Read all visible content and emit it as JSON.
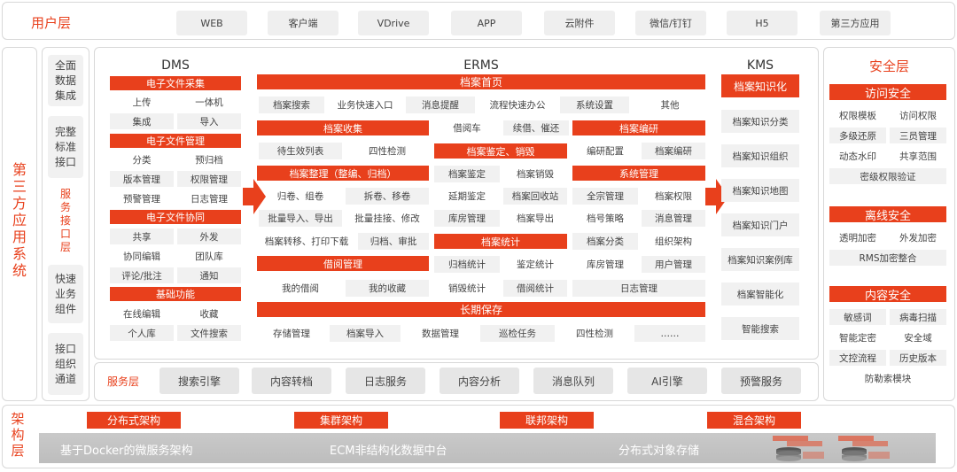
{
  "user_layer": {
    "title": "用户层",
    "items": [
      "WEB",
      "客户端",
      "VDrive",
      "APP",
      "云附件",
      "微信/钉钉",
      "H5",
      "第三方应用"
    ]
  },
  "third_party": {
    "title": "第三方应用系统",
    "boxes": [
      "全面数据集成",
      "完整标准接口",
      "服务接口层",
      "快速业务组件",
      "接口组织通道"
    ]
  },
  "dms": {
    "title": "DMS",
    "sections": [
      {
        "header": "电子文件采集",
        "items": [
          "上传",
          "一体机",
          "集成",
          "导入"
        ]
      },
      {
        "header": "电子文件管理",
        "items": [
          "分类",
          "预归档",
          "版本管理",
          "权限管理",
          "预警管理",
          "日志管理"
        ]
      },
      {
        "header": "电子文件协同",
        "items": [
          "共享",
          "外发",
          "协同编辑",
          "团队库",
          "评论/批注",
          "通知"
        ]
      },
      {
        "header": "基础功能",
        "items": [
          "在线编辑",
          "收藏",
          "个人库",
          "文件搜索"
        ]
      }
    ]
  },
  "erms": {
    "title": "ERMS",
    "home": "档案首页",
    "home_items": [
      "档案搜索",
      "业务快速入口",
      "消息提醒",
      "流程快速办公",
      "系统设置",
      "其他"
    ],
    "collect": {
      "header": "档案收集",
      "items": [
        "待生效列表",
        "四性检测"
      ]
    },
    "borrow_row": [
      "借阅车",
      "续借、催还"
    ],
    "identify": {
      "header": "档案鉴定、销毁",
      "items": [
        "档案鉴定",
        "档案销毁",
        "延期鉴定",
        "档案回收站",
        "库房管理",
        "档案导出"
      ]
    },
    "organize": {
      "header": "档案整理（整编、归档）",
      "items": [
        "归卷、组卷",
        "拆卷、移卷",
        "批量导入、导出",
        "批量挂接、修改",
        "档案转移、打印下载",
        "归档、审批"
      ]
    },
    "edit": {
      "header": "档案编研",
      "items": [
        "编研配置",
        "档案编研"
      ]
    },
    "system": {
      "header": "系统管理",
      "items": [
        "全宗管理",
        "档案权限",
        "档号策略",
        "消息管理",
        "档案分类",
        "组织架构",
        "库房管理",
        "用户管理",
        "日志管理"
      ]
    },
    "stats": {
      "header": "档案统计",
      "items": [
        "归档统计",
        "鉴定统计",
        "销毁统计",
        "借阅统计"
      ]
    },
    "borrow_mgmt": {
      "header": "借阅管理",
      "items": [
        "我的借阅",
        "我的收藏"
      ]
    },
    "long_term": {
      "header": "长期保存",
      "items": [
        "存储管理",
        "档案导入",
        "数据管理",
        "巡检任务",
        "四性检测",
        "……"
      ]
    }
  },
  "kms": {
    "title": "KMS",
    "header": "档案知识化",
    "items": [
      "档案知识分类",
      "档案知识组织",
      "档案知识地图",
      "档案知识门户",
      "档案知识案例库",
      "档案智能化",
      "智能搜索"
    ]
  },
  "service_layer": {
    "title": "服务层",
    "items": [
      "搜索引擎",
      "内容转档",
      "日志服务",
      "内容分析",
      "消息队列",
      "AI引擎",
      "预警服务"
    ]
  },
  "security": {
    "title": "安全层",
    "access": {
      "header": "访问安全",
      "items": [
        "权限模板",
        "访问权限",
        "多级还原",
        "三员管理",
        "动态水印",
        "共享范围",
        "密级权限验证"
      ]
    },
    "offline": {
      "header": "离线安全",
      "items": [
        "透明加密",
        "外发加密",
        "RMS加密整合"
      ]
    },
    "content": {
      "header": "内容安全",
      "items": [
        "敏感词",
        "病毒扫描",
        "智能定密",
        "安全域",
        "文控流程",
        "历史版本",
        "防勒索模块"
      ]
    }
  },
  "arch_layer": {
    "title": "架构层",
    "tags": [
      "分布式架构",
      "集群架构",
      "联邦架构",
      "混合架构"
    ],
    "bottom": [
      "基于Docker的微服务架构",
      "ECM非结构化数据中台",
      "分布式对象存储"
    ]
  },
  "colors": {
    "accent": "#e8401c",
    "cell": "#f1f1f1",
    "border": "#d8d8d8"
  }
}
